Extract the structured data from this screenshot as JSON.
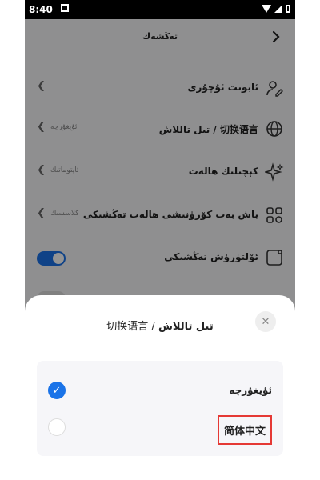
{
  "status_bar": {
    "time": "8:40"
  },
  "header": {
    "title": "تەڭشەك"
  },
  "settings": [
    {
      "label": "ئابونت ئۇچۇرى",
      "value": ""
    },
    {
      "label": "تىل تاللاش / 切换语言",
      "value": "ئۇيغۇرچە"
    },
    {
      "label": "كېچىلىك ھالەت",
      "value": "ئاپتوماتىك"
    },
    {
      "label": "باش بەت كۆرۈنىشى ھالەت تەڭشىكى",
      "value": "كلاسسىك"
    },
    {
      "label": "ئۆلتۈرۈش تەڭشىكى",
      "value": ""
    }
  ],
  "sheet": {
    "title_zh": "切换语言",
    "title_sep": " / ",
    "title_ug": "تىل تاللاش",
    "close_glyph": "✕",
    "options": [
      {
        "label": "ئۇيغۇرچە",
        "selected": true,
        "check": "✓"
      },
      {
        "label": "简体中文",
        "selected": false
      }
    ]
  }
}
